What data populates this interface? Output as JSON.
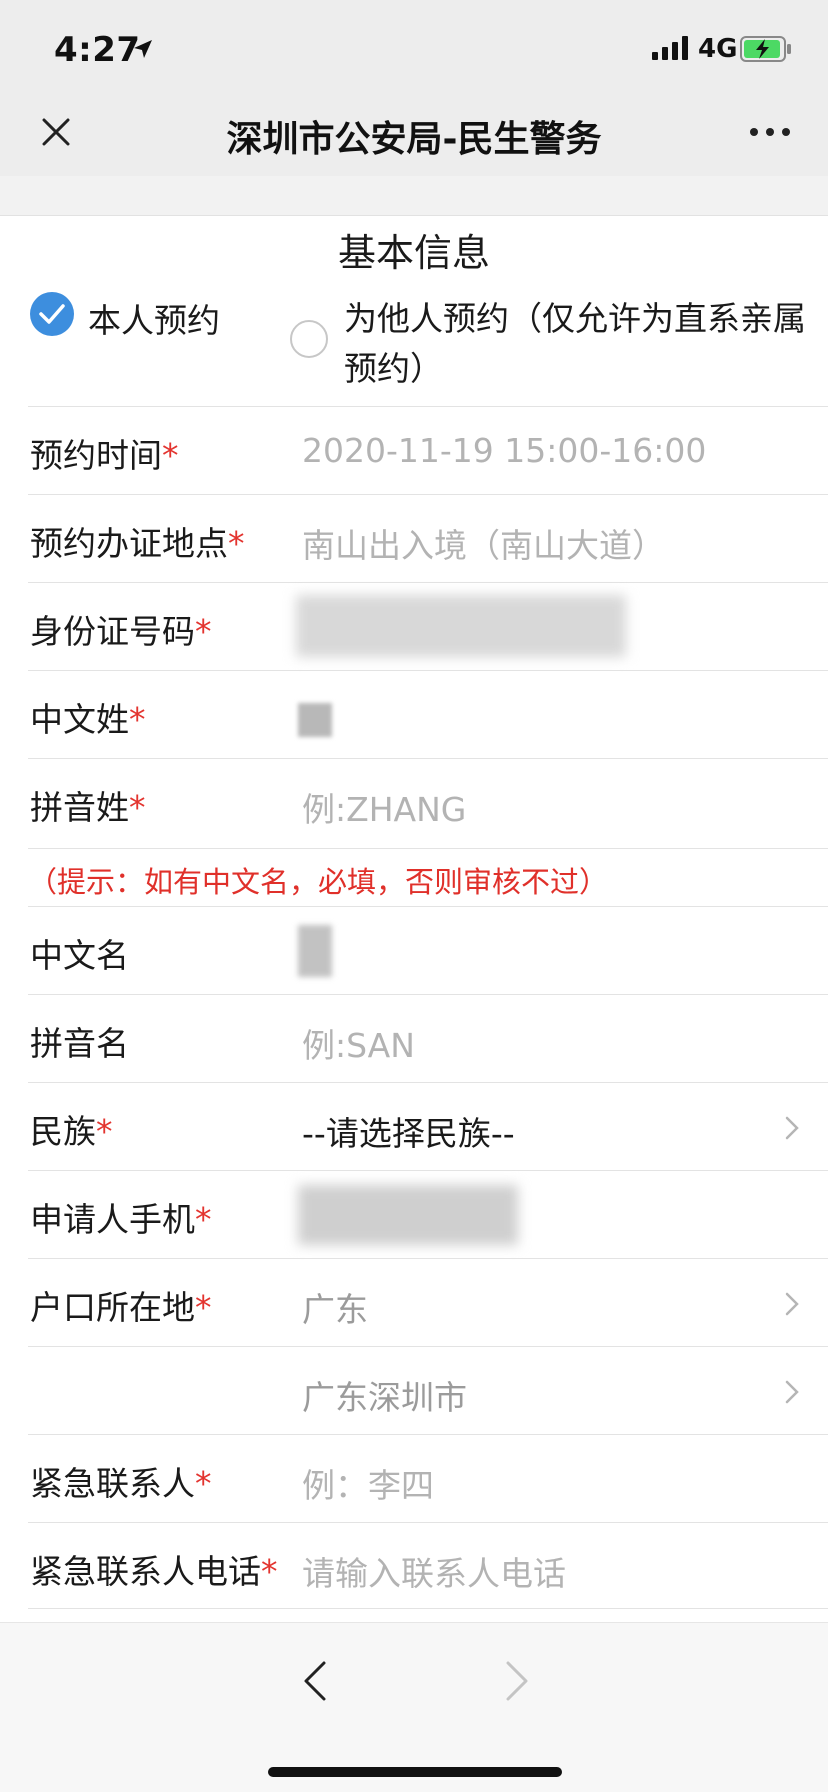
{
  "status_bar": {
    "time": "4:27",
    "network": "4G"
  },
  "nav": {
    "title": "深圳市公安局-民生警务"
  },
  "form": {
    "section_title": "基本信息",
    "radio_self_label": "本人预约",
    "radio_other_label": "为他人预约（仅允许为直系亲属预约）",
    "appointment_time": {
      "label": "预约时间",
      "value": "2020-11-19 15:00-16:00"
    },
    "location": {
      "label": "预约办证地点",
      "value": "南山出入境（南山大道）"
    },
    "id_number": {
      "label": "身份证号码"
    },
    "chinese_surname": {
      "label": "中文姓"
    },
    "pinyin_surname": {
      "label": "拼音姓",
      "placeholder": "例:ZHANG"
    },
    "hint": "（提示：如有中文名，必填，否则审核不过）",
    "chinese_given_name": {
      "label": "中文名"
    },
    "pinyin_given_name": {
      "label": "拼音名",
      "placeholder": "例:SAN"
    },
    "ethnicity": {
      "label": "民族",
      "value": "--请选择民族--"
    },
    "phone": {
      "label": "申请人手机"
    },
    "hukou": {
      "label": "户口所在地",
      "province": "广东",
      "city": "广东深圳市"
    },
    "emergency_contact": {
      "label": "紧急联系人",
      "placeholder": "例：李四"
    },
    "emergency_phone": {
      "label": "紧急联系人电话",
      "placeholder": "请输入联系人电话"
    },
    "required_mark": "*"
  },
  "colors": {
    "accent": "#3d8ede",
    "required": "#e3342f",
    "hint": "#e0302a"
  }
}
